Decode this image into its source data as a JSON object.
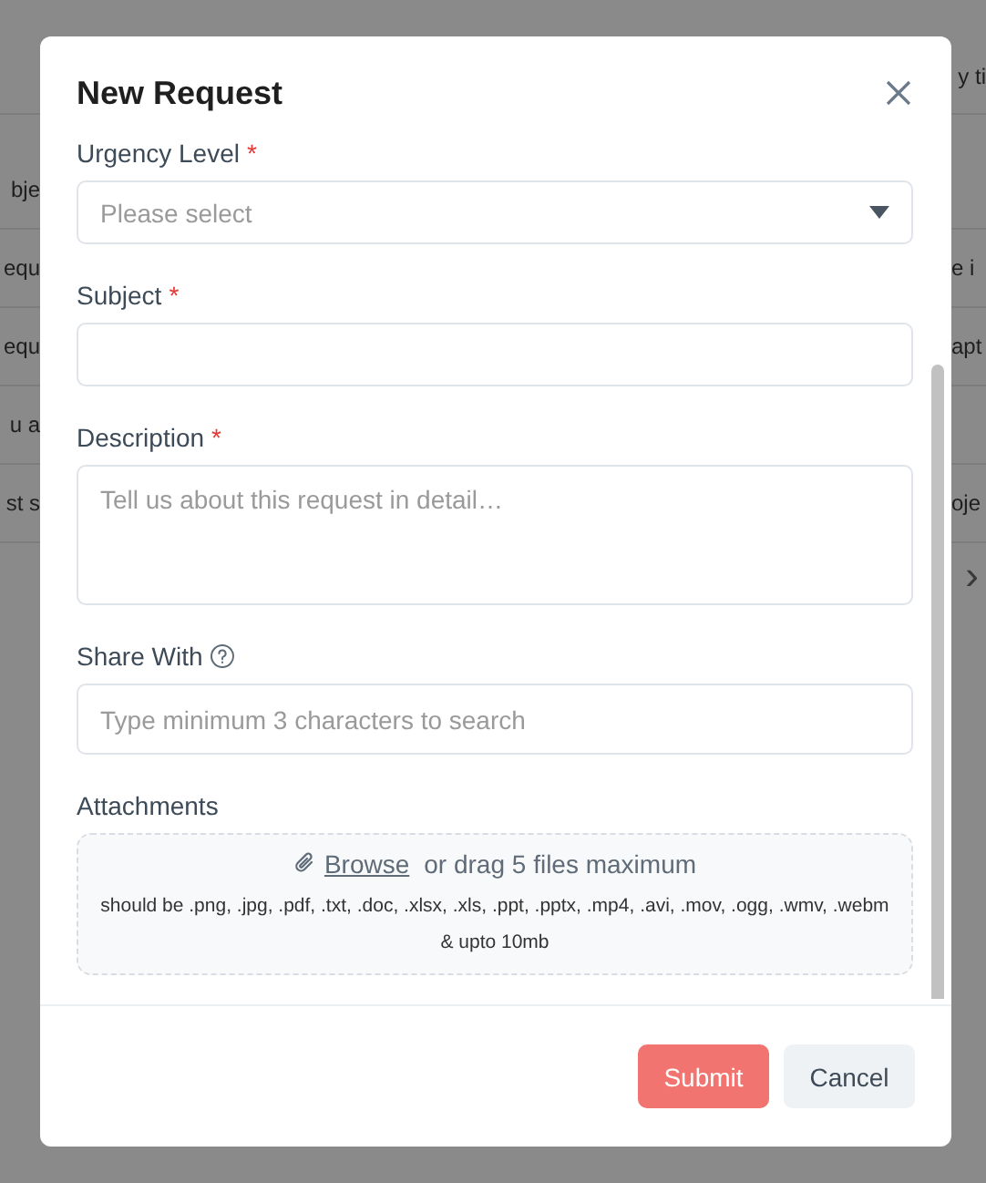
{
  "background": {
    "header_text": "y ti",
    "rows": [
      {
        "left": "bje",
        "right": ""
      },
      {
        "left": "equ",
        "right": "e i"
      },
      {
        "left": "equ",
        "right": "apt"
      },
      {
        "left": "u a",
        "right": ""
      },
      {
        "left": "st s",
        "right": "oje"
      }
    ],
    "pager": "›"
  },
  "dialog": {
    "title": "New Request",
    "fields": [
      {
        "kind": "select",
        "label": "Urgency Level",
        "required_mark": "*",
        "help": false,
        "placeholder": "Please select"
      },
      {
        "kind": "text",
        "label": "Subject",
        "required_mark": "*",
        "help": false
      },
      {
        "kind": "textarea",
        "label": "Description",
        "required_mark": "*",
        "help": false,
        "placeholder": "Tell us about this request in detail…"
      },
      {
        "kind": "text",
        "label": "Share With",
        "help": true,
        "placeholder": "Type minimum 3 characters to search"
      },
      {
        "kind": "upload",
        "label": "Attachments",
        "help": false,
        "link": "Browse",
        "text": "or drag 5 files maximum",
        "note": "should be .png, .jpg, .pdf, .txt, .doc, .xlsx, .xls, .ppt, .pptx, .mp4, .avi, .mov, .ogg, .wmv, .webm & upto 10mb"
      }
    ],
    "buttons": [
      {
        "label": "Submit",
        "kind": "primary"
      },
      {
        "label": "Cancel",
        "kind": "secondary"
      }
    ]
  }
}
